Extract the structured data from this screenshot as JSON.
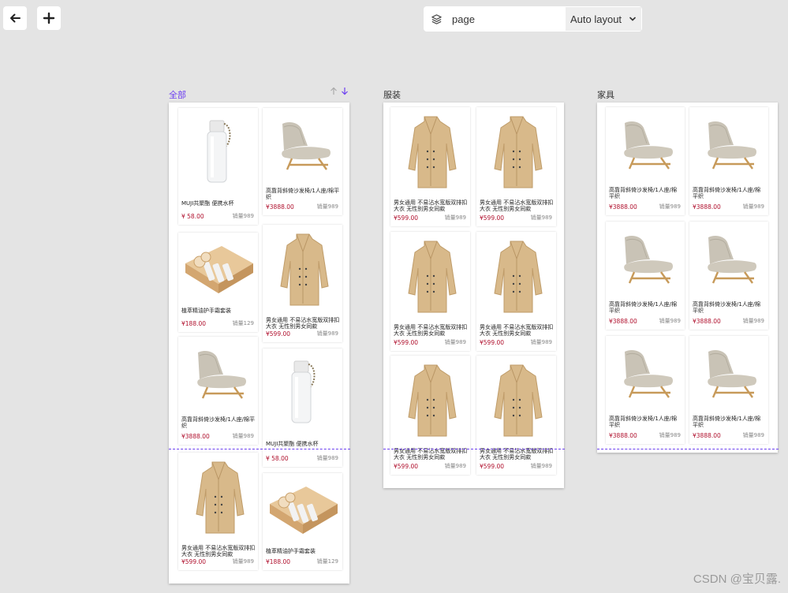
{
  "toolbar": {
    "back_icon": "arrow-left-icon",
    "add_icon": "plus-icon"
  },
  "topbar": {
    "layers_icon": "layers-icon",
    "page_name": "page",
    "layout_label": "Auto layout",
    "chevron_icon": "chevron-down-icon"
  },
  "frames": [
    {
      "title": "全部",
      "active": true,
      "products": [
        {
          "type": "bottle",
          "title": "MUJI共聚酯 便携水杯",
          "price": "¥ 58.00",
          "sales": "销量989"
        },
        {
          "type": "sofa",
          "title": "高靠背斜倚沙发椅/1人座/棉平织",
          "price": "¥3888.00",
          "sales": "销量989"
        },
        {
          "type": "box",
          "title": "植萃精油护手霜套装",
          "price": "¥188.00",
          "sales": "销量129"
        },
        {
          "type": "coat",
          "title": "男女通用 不易沾水宽版双排扣大衣 无性别男女同款",
          "price": "¥599.00",
          "sales": "销量989"
        },
        {
          "type": "sofa",
          "title": "高靠背斜倚沙发椅/1人座/棉平织",
          "price": "¥3888.00",
          "sales": "销量989"
        },
        {
          "type": "bottle",
          "title": "MUJI共聚酯 便携水杯",
          "price": "¥ 58.00",
          "sales": "销量989"
        },
        {
          "type": "coat",
          "title": "男女通用 不易沾水宽版双排扣大衣 无性别男女同款",
          "price": "¥599.00",
          "sales": "销量989"
        },
        {
          "type": "box",
          "title": "植萃精油护手霜套装",
          "price": "¥188.00",
          "sales": "销量129"
        }
      ]
    },
    {
      "title": "服装",
      "active": false,
      "products": [
        {
          "type": "coat",
          "title": "男女通用 不易沾水宽版双排扣大衣 无性别男女同款",
          "price": "¥599.00",
          "sales": "销量989"
        },
        {
          "type": "coat",
          "title": "男女通用 不易沾水宽版双排扣大衣 无性别男女同款",
          "price": "¥599.00",
          "sales": "销量989"
        },
        {
          "type": "coat",
          "title": "男女通用 不易沾水宽版双排扣大衣 无性别男女同款",
          "price": "¥599.00",
          "sales": "销量989"
        },
        {
          "type": "coat",
          "title": "男女通用 不易沾水宽版双排扣大衣 无性别男女同款",
          "price": "¥599.00",
          "sales": "销量989"
        },
        {
          "type": "coat",
          "title": "男女通用 不易沾水宽版双排扣大衣 无性别男女同款",
          "price": "¥599.00",
          "sales": "销量989"
        },
        {
          "type": "coat",
          "title": "男女通用 不易沾水宽版双排扣大衣 无性别男女同款",
          "price": "¥599.00",
          "sales": "销量989"
        }
      ]
    },
    {
      "title": "家具",
      "active": false,
      "products": [
        {
          "type": "sofa",
          "title": "高靠背斜倚沙发椅/1人座/棉平织",
          "price": "¥3888.00",
          "sales": "销量989"
        },
        {
          "type": "sofa",
          "title": "高靠背斜倚沙发椅/1人座/棉平织",
          "price": "¥3888.00",
          "sales": "销量989"
        },
        {
          "type": "sofa",
          "title": "高靠背斜倚沙发椅/1人座/棉平织",
          "price": "¥3888.00",
          "sales": "销量989"
        },
        {
          "type": "sofa",
          "title": "高靠背斜倚沙发椅/1人座/棉平织",
          "price": "¥3888.00",
          "sales": "销量989"
        },
        {
          "type": "sofa",
          "title": "高靠背斜倚沙发椅/1人座/棉平织",
          "price": "¥3888.00",
          "sales": "销量989"
        },
        {
          "type": "sofa",
          "title": "高靠背斜倚沙发椅/1人座/棉平织",
          "price": "¥3888.00",
          "sales": "销量989"
        }
      ]
    }
  ],
  "sort_icons": [
    "arrow-up-icon",
    "arrow-down-icon"
  ],
  "watermark": "CSDN @宝贝露."
}
